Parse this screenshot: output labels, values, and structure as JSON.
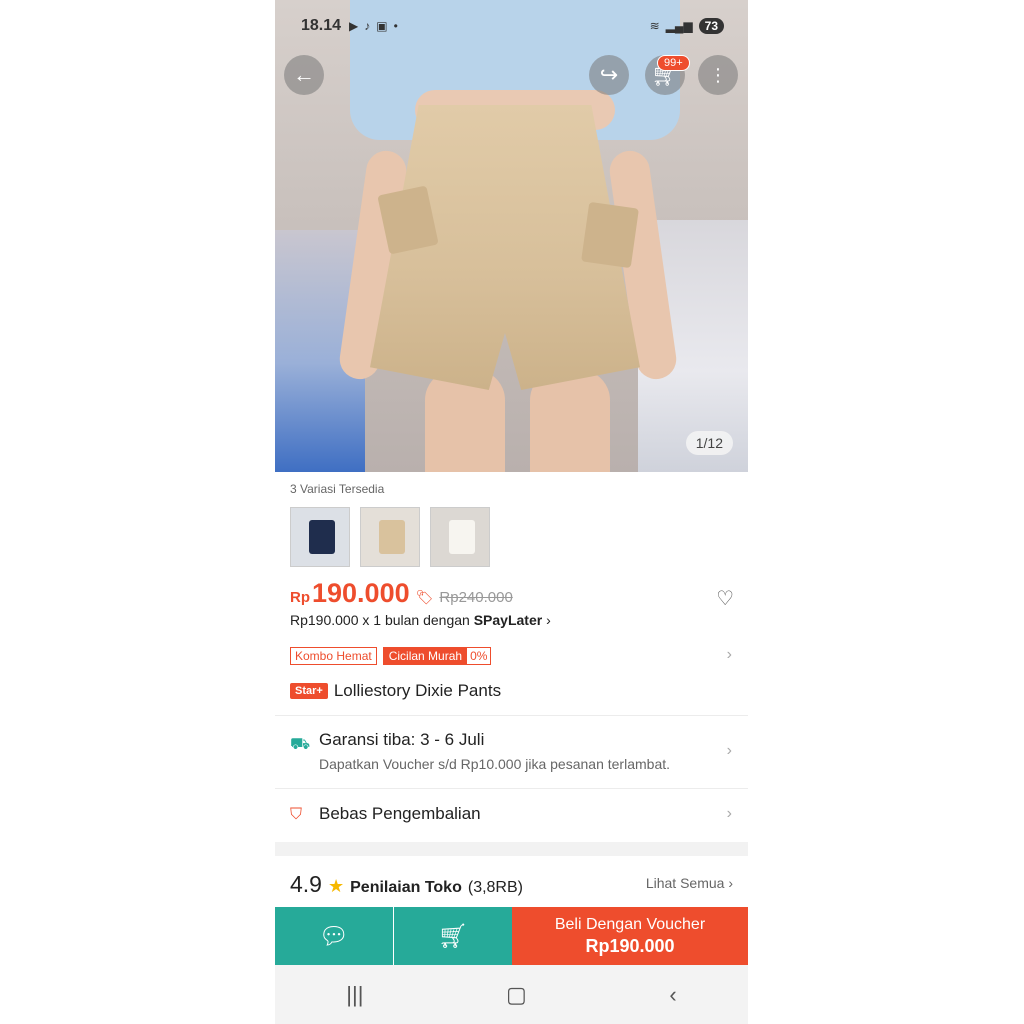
{
  "status_bar": {
    "time": "18.14",
    "battery": "73"
  },
  "hero": {
    "image_counter": "1/12",
    "cart_badge": "99+"
  },
  "variants": {
    "label": "3 Variasi Tersedia",
    "swatches": [
      {
        "name": "navy",
        "color": "#1f2d4d"
      },
      {
        "name": "khaki",
        "color": "#d9c29d"
      },
      {
        "name": "white",
        "color": "#f2f0eb"
      }
    ]
  },
  "price": {
    "currency": "Rp",
    "current": "190.000",
    "original": "Rp240.000",
    "paylater_prefix": "Rp190.000 x 1 bulan dengan ",
    "paylater_brand": "SPayLater"
  },
  "promos": {
    "combo": "Kombo Hemat",
    "installment": "Cicilan Murah",
    "installment_rate": "0%"
  },
  "product": {
    "badge": "Star+",
    "title": "Lolliestory Dixie Pants"
  },
  "shipping": {
    "title": "Garansi tiba: 3 - 6 Juli",
    "subtitle": "Dapatkan Voucher s/d Rp10.000 jika pesanan terlambat."
  },
  "returns": {
    "title": "Bebas Pengembalian"
  },
  "rating": {
    "score": "4.9",
    "label": "Penilaian Toko",
    "count": "(3,8RB)",
    "see_all": "Lihat Semua"
  },
  "bottom_bar": {
    "buy_label": "Beli Dengan Voucher",
    "buy_price": "Rp190.000"
  },
  "colors": {
    "accent": "#ee4d2d",
    "secondary": "#26aa99",
    "rating_star": "#f6b800"
  }
}
